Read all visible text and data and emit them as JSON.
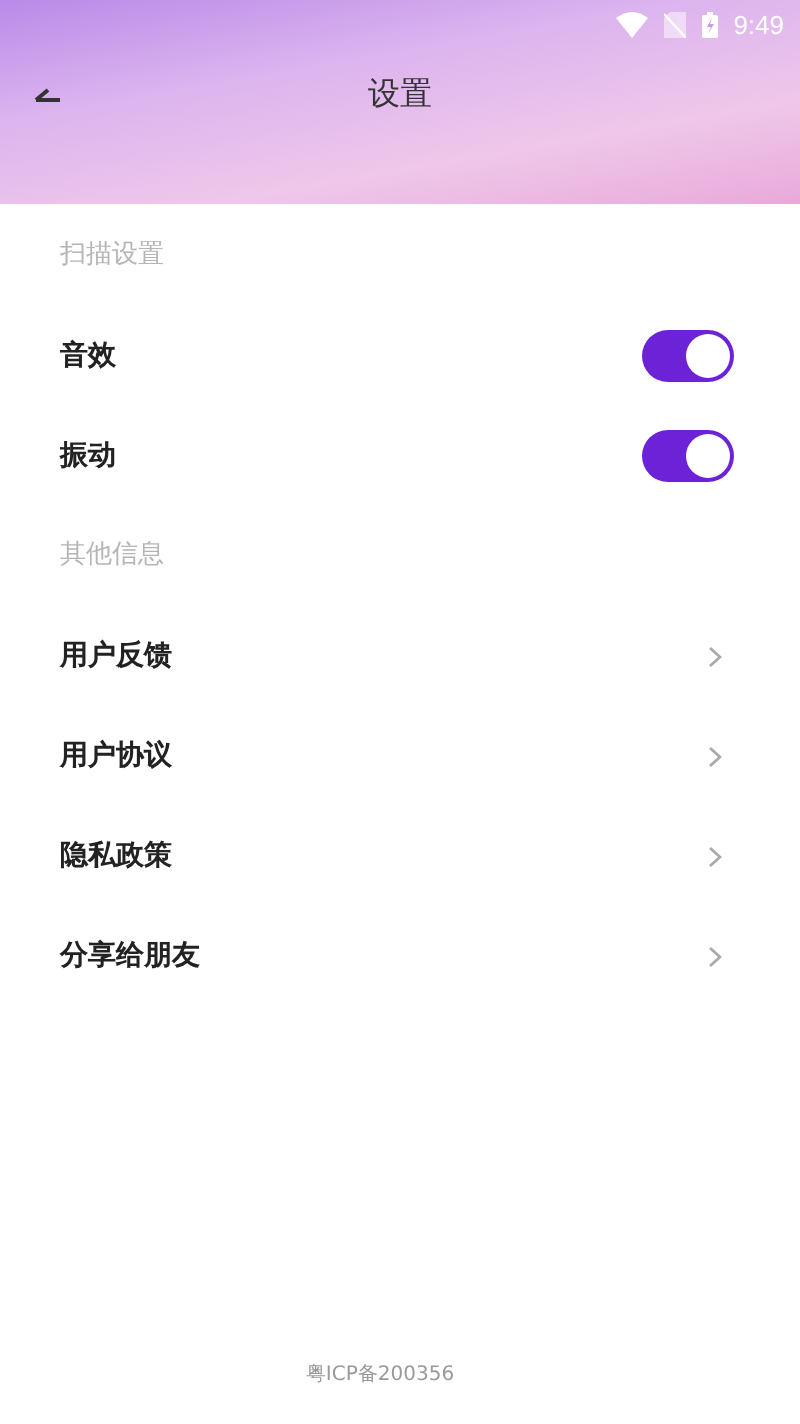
{
  "status_bar": {
    "time": "9:49"
  },
  "header": {
    "title": "设置"
  },
  "sections": [
    {
      "label": "扫描设置",
      "items": [
        {
          "kind": "toggle",
          "label": "音效",
          "on": true
        },
        {
          "kind": "toggle",
          "label": "振动",
          "on": true
        }
      ]
    },
    {
      "label": "其他信息",
      "items": [
        {
          "kind": "link",
          "label": "用户反馈"
        },
        {
          "kind": "link",
          "label": "用户协议"
        },
        {
          "kind": "link",
          "label": "隐私政策"
        },
        {
          "kind": "link",
          "label": "分享给朋友"
        }
      ]
    }
  ],
  "footer": {
    "text": "粤ICP备200356"
  }
}
